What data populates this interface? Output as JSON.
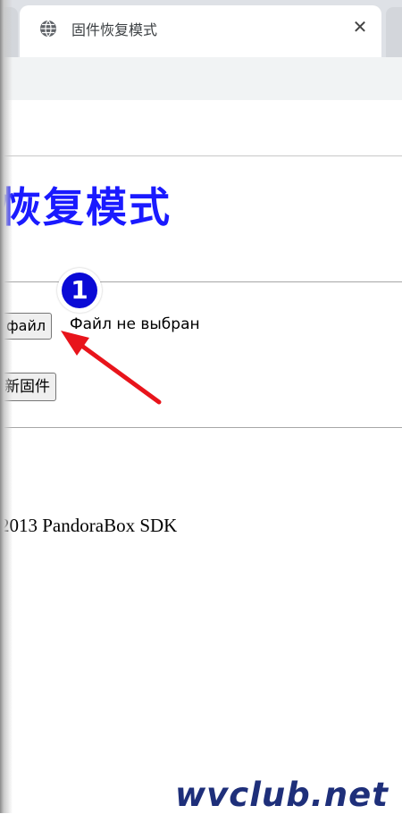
{
  "browser": {
    "tab": {
      "title": "固件恢复模式",
      "close_glyph": "✕",
      "favicon": "globe-icon"
    }
  },
  "page": {
    "heading": "恢复模式",
    "upload": {
      "file_button_label": "файл",
      "file_status": "Файл не выбран",
      "submit_label": "新固件"
    },
    "footer": "2013 PandoraBox SDK"
  },
  "annotation": {
    "step_number": "1",
    "step_color": "#0a0ad6",
    "arrow_color": "#e8141b"
  },
  "watermark": "wvclub.net",
  "colors": {
    "heading": "#1a1aff",
    "tabbar": "#dee1e6",
    "toolbar": "#f1f3f4"
  }
}
